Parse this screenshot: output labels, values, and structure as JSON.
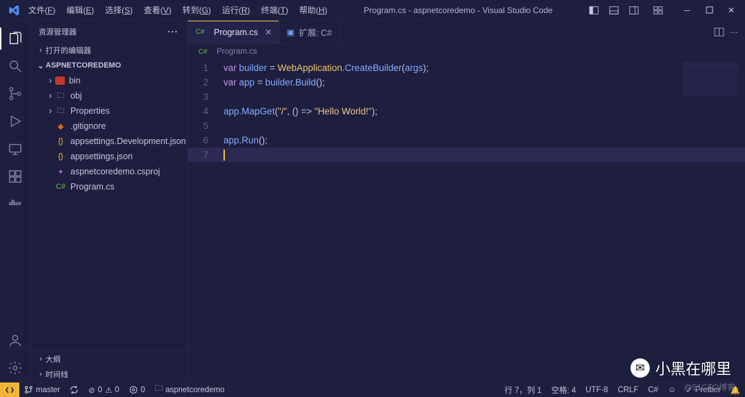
{
  "title": "Program.cs - aspnetcoredemo - Visual Studio Code",
  "menu": [
    {
      "label": "文件",
      "key": "F"
    },
    {
      "label": "编辑",
      "key": "E"
    },
    {
      "label": "选择",
      "key": "S"
    },
    {
      "label": "查看",
      "key": "V"
    },
    {
      "label": "转到",
      "key": "G"
    },
    {
      "label": "运行",
      "key": "R"
    },
    {
      "label": "终端",
      "key": "T"
    },
    {
      "label": "帮助",
      "key": "H"
    }
  ],
  "sidebar": {
    "header": "资源管理器",
    "sections": {
      "openEditors": "打开的编辑器",
      "project": "ASPNETCOREDEMO",
      "outline": "大纲",
      "timeline": "时间线"
    },
    "tree": [
      {
        "indent": 1,
        "chev": "›",
        "name": "bin",
        "icon": "folder-red"
      },
      {
        "indent": 1,
        "chev": "›",
        "name": "obj",
        "icon": "folder"
      },
      {
        "indent": 1,
        "chev": "›",
        "name": "Properties",
        "icon": "folder"
      },
      {
        "indent": 1,
        "chev": "",
        "name": ".gitignore",
        "icon": "git"
      },
      {
        "indent": 1,
        "chev": "",
        "name": "appsettings.Development.json",
        "icon": "json"
      },
      {
        "indent": 1,
        "chev": "",
        "name": "appsettings.json",
        "icon": "json"
      },
      {
        "indent": 1,
        "chev": "",
        "name": "aspnetcoredemo.csproj",
        "icon": "csproj"
      },
      {
        "indent": 1,
        "chev": "",
        "name": "Program.cs",
        "icon": "cs"
      }
    ]
  },
  "tabs": [
    {
      "icon": "cs",
      "label": "Program.cs",
      "active": true,
      "close": true
    },
    {
      "icon": "ext",
      "label": "扩展: C#",
      "active": false,
      "close": false
    }
  ],
  "breadcrumb": {
    "icon": "cs",
    "label": "Program.cs"
  },
  "code": {
    "lines": 7,
    "l1": {
      "a": "var",
      "b": "builder",
      "c": "WebApplication",
      "d": "CreateBuilder",
      "e": "args"
    },
    "l2": {
      "a": "var",
      "b": "app",
      "c": "builder",
      "d": "Build"
    },
    "l4": {
      "a": "app",
      "b": "MapGet",
      "c": "\"/\"",
      "d": "\"Hello World!\""
    },
    "l6": {
      "a": "app",
      "b": "Run"
    }
  },
  "status": {
    "branch": "master",
    "sync": "",
    "errors": "0",
    "warnings": "0",
    "port": "0",
    "folder": "aspnetcoredemo",
    "pos": "行 7，列 1",
    "spaces": "空格: 4",
    "encoding": "UTF-8",
    "eol": "CRLF",
    "lang": "C#",
    "bell": "",
    "prettier": "Prettier"
  },
  "watermark": {
    "text": "小黑在哪里",
    "sub": "@51CTO博客"
  }
}
